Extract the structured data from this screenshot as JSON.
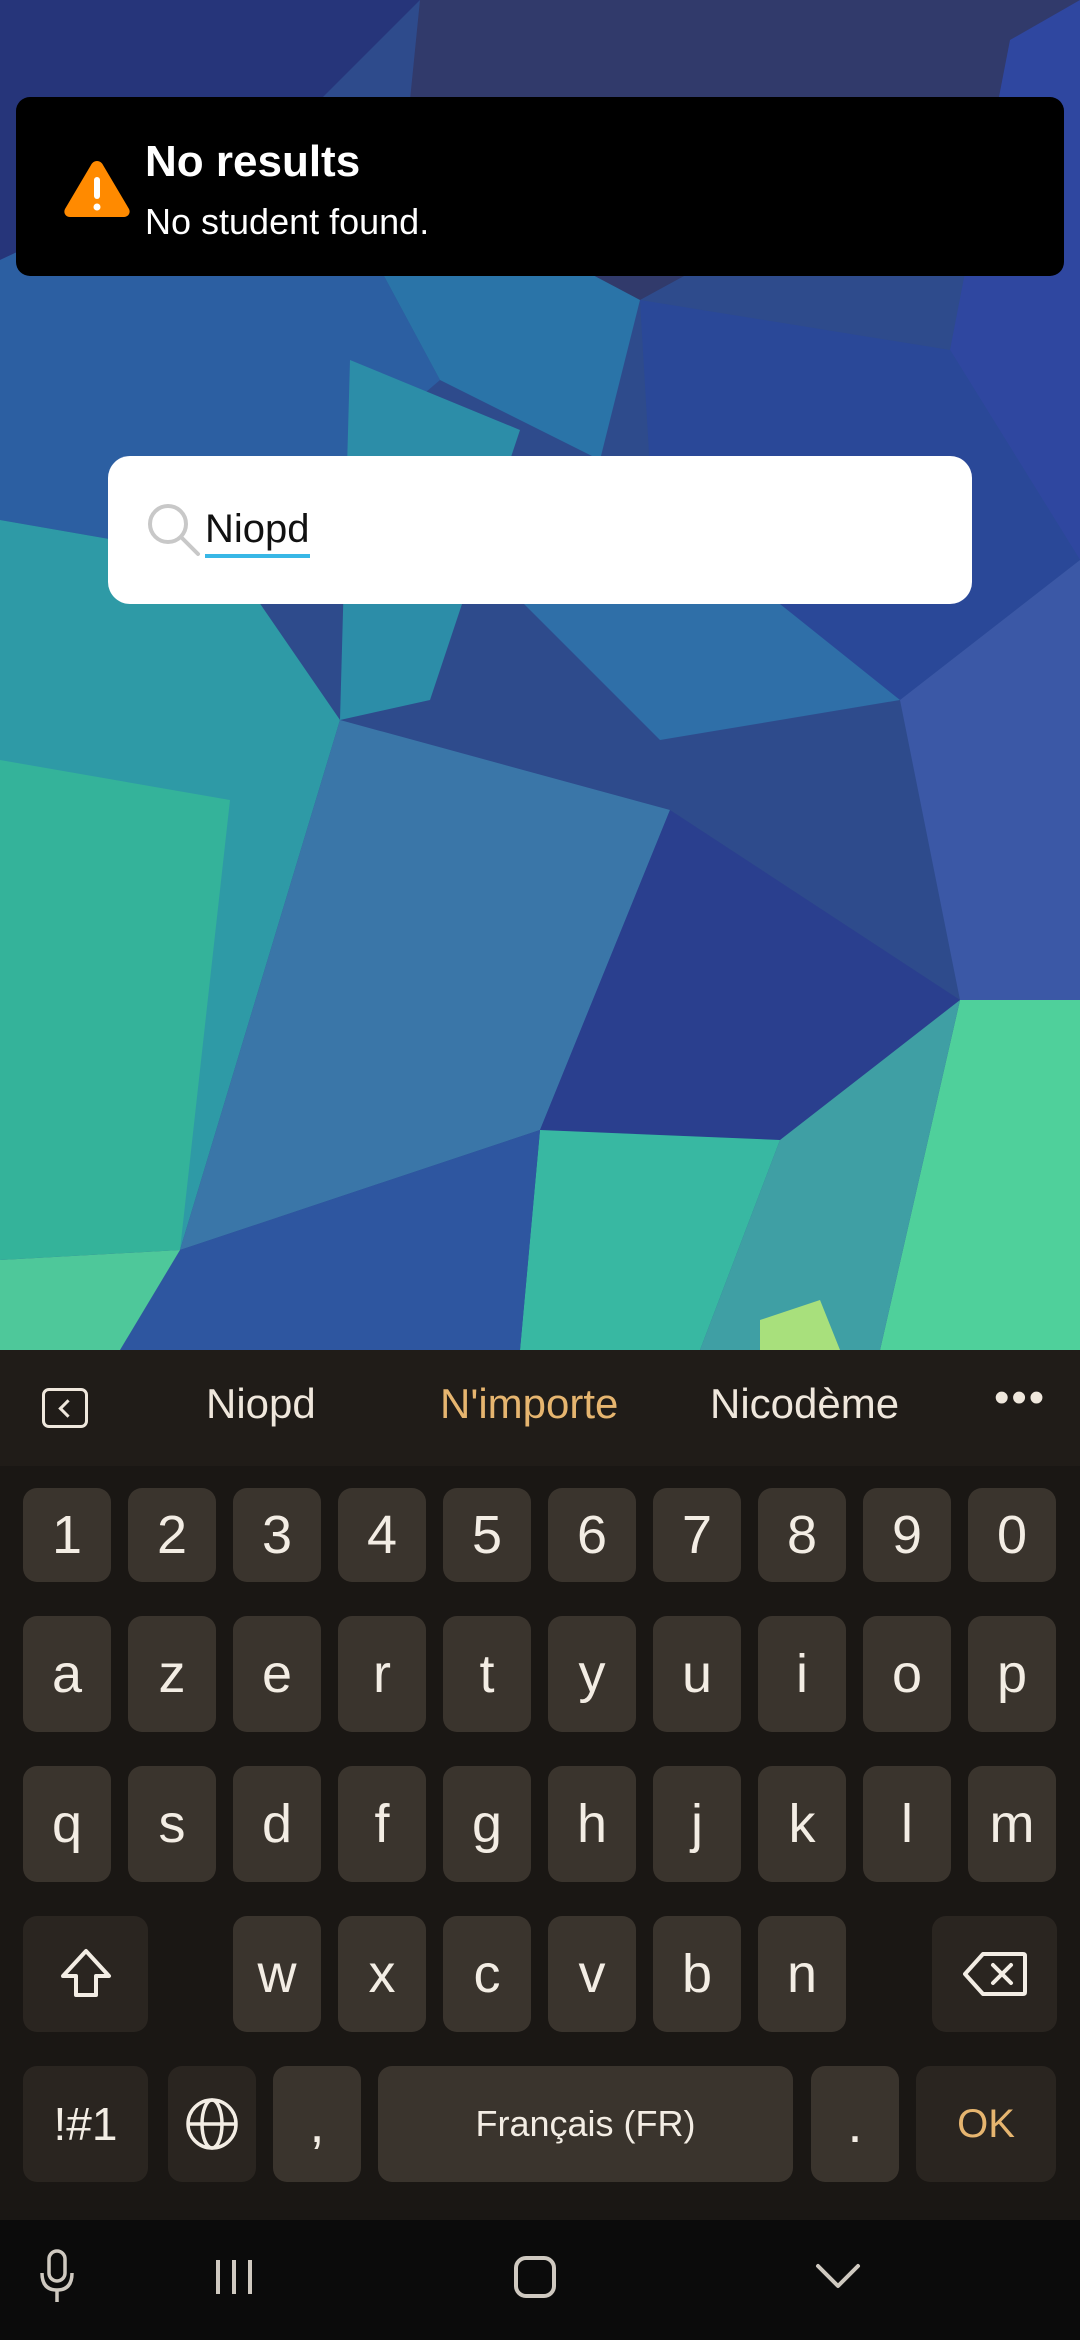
{
  "toast": {
    "title": "No results",
    "message": "No student found.",
    "icon": "warning-icon",
    "icon_color": "#ff8a00"
  },
  "search": {
    "value": "Niopd",
    "underline_color": "#38b7e6"
  },
  "keyboard": {
    "suggestions": [
      "Niopd",
      "N'importe",
      "Nicodème"
    ],
    "highlight_color": "#e6b56f",
    "row_numbers": [
      "1",
      "2",
      "3",
      "4",
      "5",
      "6",
      "7",
      "8",
      "9",
      "0"
    ],
    "row1": [
      "a",
      "z",
      "e",
      "r",
      "t",
      "y",
      "u",
      "i",
      "o",
      "p"
    ],
    "row2": [
      "q",
      "s",
      "d",
      "f",
      "g",
      "h",
      "j",
      "k",
      "l",
      "m"
    ],
    "row3": [
      "w",
      "x",
      "c",
      "v",
      "b",
      "n"
    ],
    "symbols_label": "!#1",
    "comma_label": ",",
    "space_label": "Français (FR)",
    "period_label": ".",
    "ok_label": "OK"
  }
}
